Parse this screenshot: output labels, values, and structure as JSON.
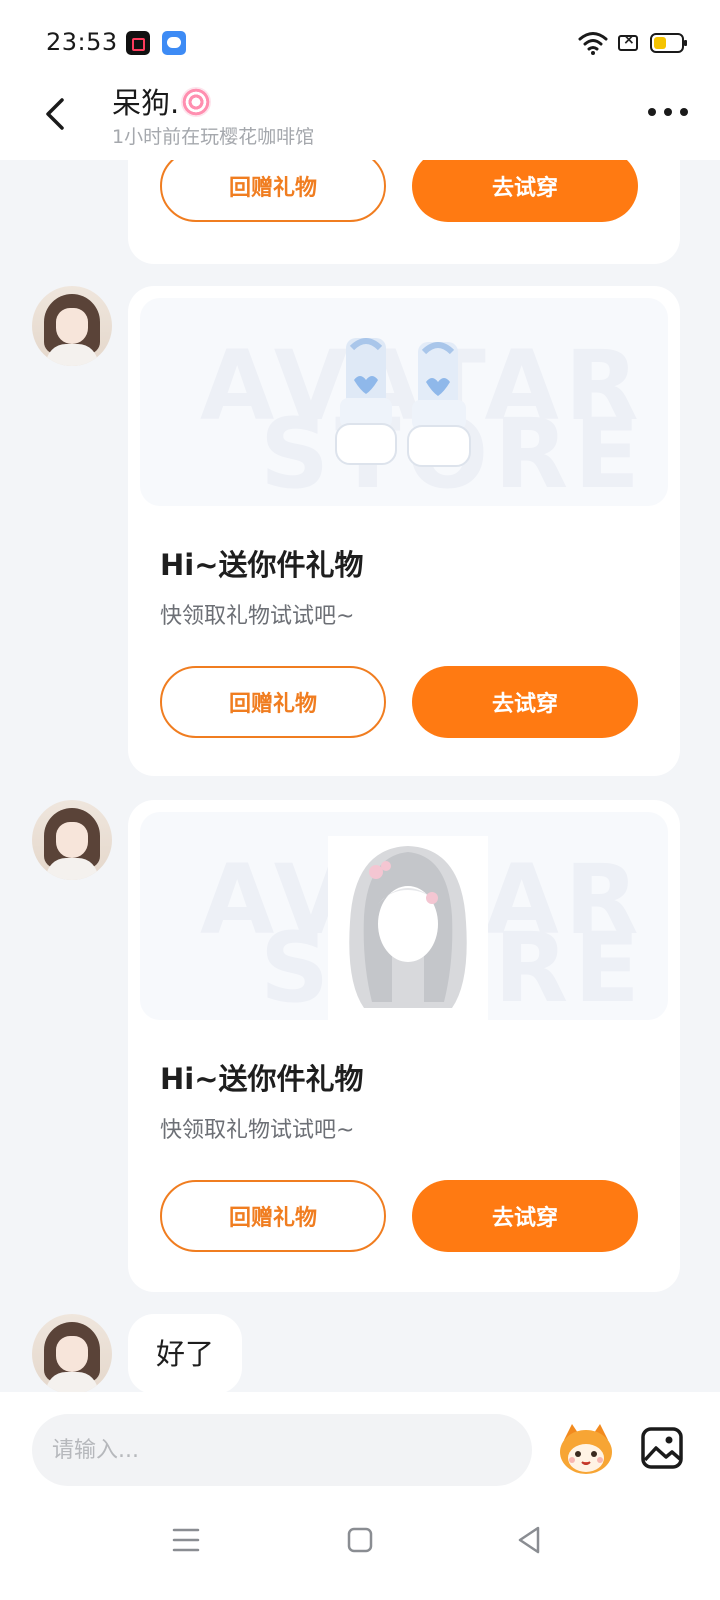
{
  "status_bar": {
    "time": "23:53",
    "battery_level": 0.45
  },
  "header": {
    "title": "呆狗.",
    "subtitle": "1小时前在玩樱花咖啡馆"
  },
  "messages": [
    {
      "type": "gift",
      "return_label": "回赠礼物",
      "try_label": "去试穿"
    },
    {
      "type": "gift",
      "item_icon": "boots",
      "watermark": [
        "AVATAR",
        "STORE"
      ],
      "title": "Hi~送你件礼物",
      "subtitle": "快领取礼物试试吧~",
      "return_label": "回赠礼物",
      "try_label": "去试穿"
    },
    {
      "type": "gift",
      "item_icon": "silver-hair",
      "watermark": [
        "AVATAR",
        "STORE"
      ],
      "title": "Hi~送你件礼物",
      "subtitle": "快领取礼物试试吧~",
      "return_label": "回赠礼物",
      "try_label": "去试穿"
    },
    {
      "type": "text",
      "text": "好了"
    }
  ],
  "input_bar": {
    "placeholder": "请输入..."
  },
  "colors": {
    "accent": "#ff7a12",
    "accent_outline": "#f07d20",
    "background": "#f3f5f8"
  }
}
